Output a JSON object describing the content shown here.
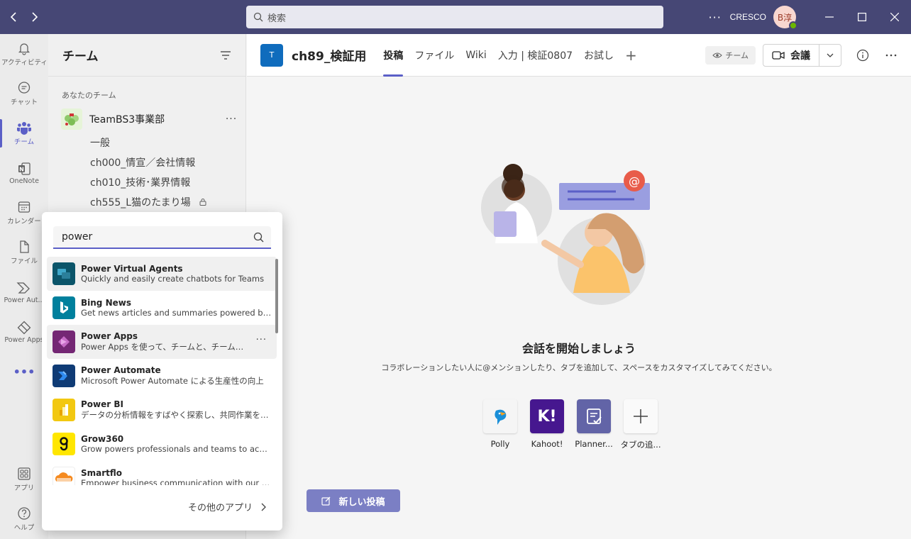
{
  "titlebar": {
    "search_placeholder": "検索",
    "more": "···",
    "org": "CRESCO",
    "avatar_initials": "B淳"
  },
  "rail": [
    {
      "label": "アクティビティ",
      "icon": "bell-icon"
    },
    {
      "label": "チャット",
      "icon": "chat-icon"
    },
    {
      "label": "チーム",
      "icon": "teams-icon",
      "active": true
    },
    {
      "label": "OneNote",
      "icon": "onenote-icon"
    },
    {
      "label": "カレンダー",
      "icon": "calendar-icon"
    },
    {
      "label": "ファイル",
      "icon": "file-icon"
    },
    {
      "label": "Power Aut...",
      "icon": "power-automate-icon"
    },
    {
      "label": "Power Apps",
      "icon": "power-apps-icon"
    },
    {
      "label": "•••",
      "icon": "more-icon"
    },
    {
      "label": "アプリ",
      "icon": "apps-icon"
    },
    {
      "label": "ヘルプ",
      "icon": "help-icon"
    }
  ],
  "teams_pane": {
    "title": "チーム",
    "section": "あなたのチーム",
    "team_name": "TeamBS3事業部",
    "more": "···",
    "channels": [
      "一般",
      "ch000_情宣／会社情報",
      "ch010_技術･業界情報",
      "ch555_L猫のたまり場"
    ]
  },
  "main": {
    "channel_avatar": "T",
    "channel_title": "ch89_検証用",
    "tabs": [
      "投稿",
      "ファイル",
      "Wiki",
      "入力 | 検証0807",
      "お試し"
    ],
    "tab_add": "+",
    "team_pill": "チーム",
    "meet_label": "会議",
    "empty_title": "会話を開始しましょう",
    "empty_sub": "コラボレーションしたい人に@メンションしたり、タブを追加して、スペースをカスタマイズしてみてください。",
    "apps": [
      {
        "name": "Polly",
        "icon": "polly-icon",
        "bg": "#f5f5f5"
      },
      {
        "name": "Kahoot!",
        "icon": "kahoot-icon",
        "bg": "#46178f"
      },
      {
        "name": "Planner...",
        "icon": "planner-icon",
        "bg": "#6264a7"
      },
      {
        "name": "タブの追...",
        "icon": "plus-icon",
        "bg": "#fafafa"
      }
    ],
    "new_post": "新しい投稿"
  },
  "flyout": {
    "search_value": "power",
    "items": [
      {
        "name": "Power Virtual Agents",
        "desc": "Quickly and easily create chatbots for Teams",
        "bg": "#0b556a"
      },
      {
        "name": "Bing News",
        "desc": "Get news articles and summaries powered by Bin...",
        "bg": "#00809d"
      },
      {
        "name": "Power Apps",
        "desc": "Power Apps を使って、チームと、チームで最もよく...",
        "bg": "#742774",
        "more": "···"
      },
      {
        "name": "Power Automate",
        "desc": "Microsoft Power Automate による生産性の向上",
        "bg": "#0f3b75"
      },
      {
        "name": "Power BI",
        "desc": "データの分析情報をすばやく探索し、共同作業を行いま...",
        "bg": "#f2c811"
      },
      {
        "name": "Grow360",
        "desc": "Grow powers professionals and teams to achieve...",
        "bg": "#ffe600"
      },
      {
        "name": "Smartflo",
        "desc": "Empower business communication with our easy...",
        "bg": "#ffffff"
      }
    ],
    "more_apps": "その他のアプリ"
  }
}
